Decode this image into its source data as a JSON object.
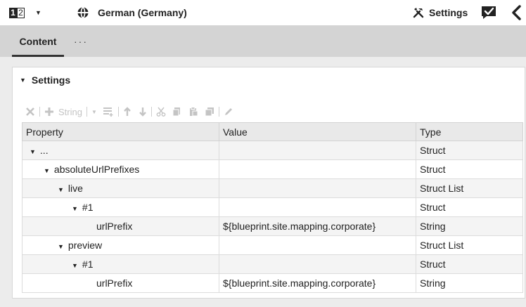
{
  "topbar": {
    "badge_one": "1",
    "badge_two": "2",
    "language": "German (Germany)",
    "settings_label": "Settings"
  },
  "tabs": {
    "content_label": "Content",
    "more_label": "···"
  },
  "panel": {
    "title": "Settings",
    "toolbar": {
      "add_label": "String"
    }
  },
  "grid": {
    "headers": {
      "property": "Property",
      "value": "Value",
      "type": "Type"
    },
    "rows": [
      {
        "property": "...",
        "value": "",
        "type": "Struct"
      },
      {
        "property": "absoluteUrlPrefixes",
        "value": "",
        "type": "Struct"
      },
      {
        "property": "live",
        "value": "",
        "type": "Struct List"
      },
      {
        "property": "#1",
        "value": "",
        "type": "Struct"
      },
      {
        "property": "urlPrefix",
        "value": "${blueprint.site.mapping.corporate}",
        "type": "String"
      },
      {
        "property": "preview",
        "value": "",
        "type": "Struct List"
      },
      {
        "property": "#1",
        "value": "",
        "type": "Struct"
      },
      {
        "property": "urlPrefix",
        "value": "${blueprint.site.mapping.corporate}",
        "type": "String"
      }
    ]
  },
  "colors": {
    "tab_strip": "#d4d4d4",
    "content_bg": "#ececec",
    "header_row": "#e9e9e9",
    "alt_row": "#f4f4f4",
    "toolbar_disabled": "#c4c4c4"
  },
  "icons": [
    "chevron-down-icon",
    "globe-icon",
    "tools-icon",
    "check-chat-icon",
    "chevron-left-icon",
    "collapse-triangle-icon",
    "close-icon",
    "plus-icon",
    "list-icon",
    "arrow-up-icon",
    "arrow-down-icon",
    "cut-icon",
    "copy-icon",
    "paste-icon",
    "duplicate-icon",
    "pencil-icon"
  ]
}
